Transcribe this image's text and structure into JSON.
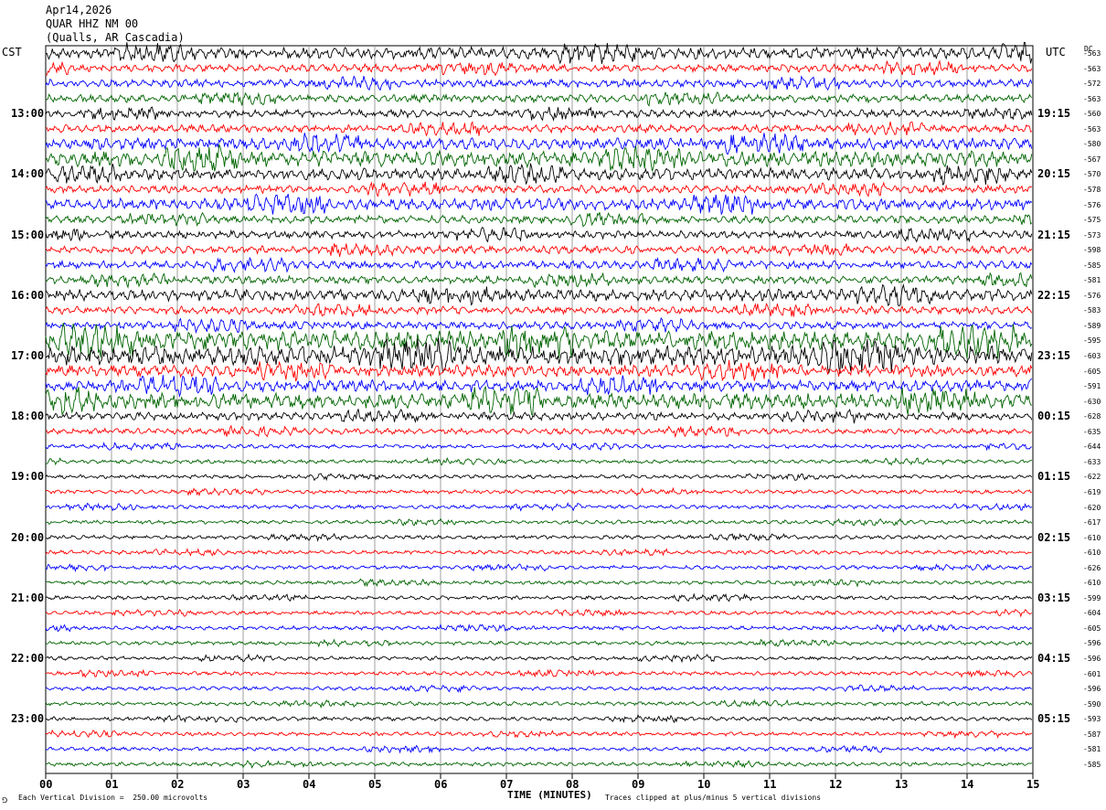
{
  "header": {
    "date": "Apr14,2026",
    "station": "QUAR HHZ NM 00",
    "location": "(Qualls, AR Cascadia)"
  },
  "left_tz": "CST",
  "right_tz": "UTC",
  "dc_label": "DC",
  "footer": {
    "scale_note": "Each Vertical Division =  250.00 microvolts",
    "clip_note": "Traces clipped at plus/minus 5 vertical divisions",
    "corner_mark": "⅁"
  },
  "chart_data": {
    "type": "line",
    "title": "QUAR HHZ NM 00 (Qualls, AR Cascadia) Apr14,2026",
    "xlabel": "TIME (MINUTES)",
    "x_ticks": [
      "00",
      "01",
      "02",
      "03",
      "04",
      "05",
      "06",
      "07",
      "08",
      "09",
      "10",
      "11",
      "12",
      "13",
      "14",
      "15"
    ],
    "xlim": [
      0,
      15
    ],
    "trace_minutes": 15,
    "trace_colors": [
      "#000000",
      "#ff0000",
      "#0000ff",
      "#006400"
    ],
    "left_hour_labels": [
      "13:00",
      "14:00",
      "15:00",
      "16:00",
      "17:00",
      "18:00",
      "19:00",
      "20:00",
      "21:00",
      "22:00",
      "23:00"
    ],
    "right_hour_labels": [
      "19:15",
      "20:15",
      "21:15",
      "22:15",
      "23:15",
      "00:15",
      "01:15",
      "02:15",
      "03:15",
      "04:15",
      "05:15"
    ],
    "dc_offsets": [
      -563,
      -563,
      -572,
      -563,
      -560,
      -563,
      -580,
      -567,
      -570,
      -578,
      -576,
      -575,
      -573,
      -598,
      -585,
      -581,
      -576,
      -583,
      -589,
      -595,
      -603,
      -605,
      -591,
      -630,
      -628,
      -635,
      -644,
      -633,
      -622,
      -619,
      -620,
      -617,
      -610,
      -610,
      -626,
      -610,
      -599,
      -604,
      -605,
      -596,
      -596,
      -601,
      -596,
      -590,
      -593,
      -587,
      -581,
      -585
    ],
    "trace_activity": [
      3,
      2,
      2,
      2,
      2,
      2,
      3,
      4,
      3,
      2,
      3,
      2,
      2,
      2,
      2,
      2,
      3,
      2,
      2,
      5,
      5,
      3,
      3,
      4,
      2,
      1.5,
      1,
      1,
      1,
      1,
      1,
      1,
      1,
      1,
      1,
      1,
      1,
      1,
      1,
      1,
      1,
      1,
      1,
      1,
      1,
      1,
      1,
      1
    ],
    "scale_microvolts_per_division": 250.0,
    "clip_divisions": 5
  }
}
